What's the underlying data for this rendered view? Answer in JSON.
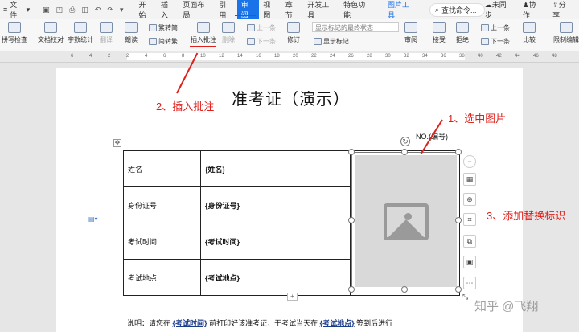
{
  "menubar": {
    "file": "文件",
    "tabs": [
      "开始",
      "插入",
      "页面布局",
      "引用",
      "审阅",
      "视图",
      "章节",
      "开发工具",
      "特色功能"
    ],
    "active_tab": "审阅",
    "picture_tools": "图片工具",
    "search": "查找命令...",
    "sync": "未同步",
    "collab": "协作",
    "share": "分享"
  },
  "ribbon": {
    "spellcheck": "拼写检查",
    "proofread": "文档校对",
    "wordcount": "字数统计",
    "translate": "翻译",
    "read": "朗读",
    "trad_simp": "繁转简",
    "simp_trad": "简转繁",
    "insert_comment": "插入批注",
    "delete": "删除",
    "prev": "上一条",
    "next": "下一条",
    "track": "修订",
    "show_markup_final": "显示标记的最终状态",
    "show_markup": "显示标记",
    "review": "审阅",
    "accept": "接受",
    "reject": "拒绝",
    "prev2": "上一条",
    "next2": "下一条",
    "compare": "比较",
    "restrict": "限制编辑"
  },
  "ruler_ticks": [
    "6",
    "4",
    "2",
    "2",
    "4",
    "6",
    "8",
    "10",
    "12",
    "14",
    "16",
    "18",
    "20",
    "22",
    "24",
    "26",
    "28",
    "30",
    "32",
    "34",
    "36",
    "38",
    "40",
    "42",
    "44",
    "46",
    "48"
  ],
  "document": {
    "title": "准考证（演示）",
    "no_label": "NO.(编号)",
    "rows": [
      {
        "label": "姓名",
        "value": "{姓名}"
      },
      {
        "label": "身份证号",
        "value": "{身份证号}"
      },
      {
        "label": "考试时间",
        "value": "{考试时间}"
      },
      {
        "label": "考试地点",
        "value": "{考试地点}"
      }
    ],
    "note_prefix": "说明：请您在",
    "note_field1": "{考试时间}",
    "note_mid": "前打印好该准考证，于考试当天在",
    "note_field2": "{考试地点}",
    "note_suffix": "签到后进行"
  },
  "annotations": {
    "step1": "1、选中图片",
    "step2": "2、插入批注",
    "step3": "3、添加替换标识"
  },
  "watermark": "知乎 @飞翔",
  "colors": {
    "accent": "#1a73e8",
    "annotation": "#e0201c"
  }
}
